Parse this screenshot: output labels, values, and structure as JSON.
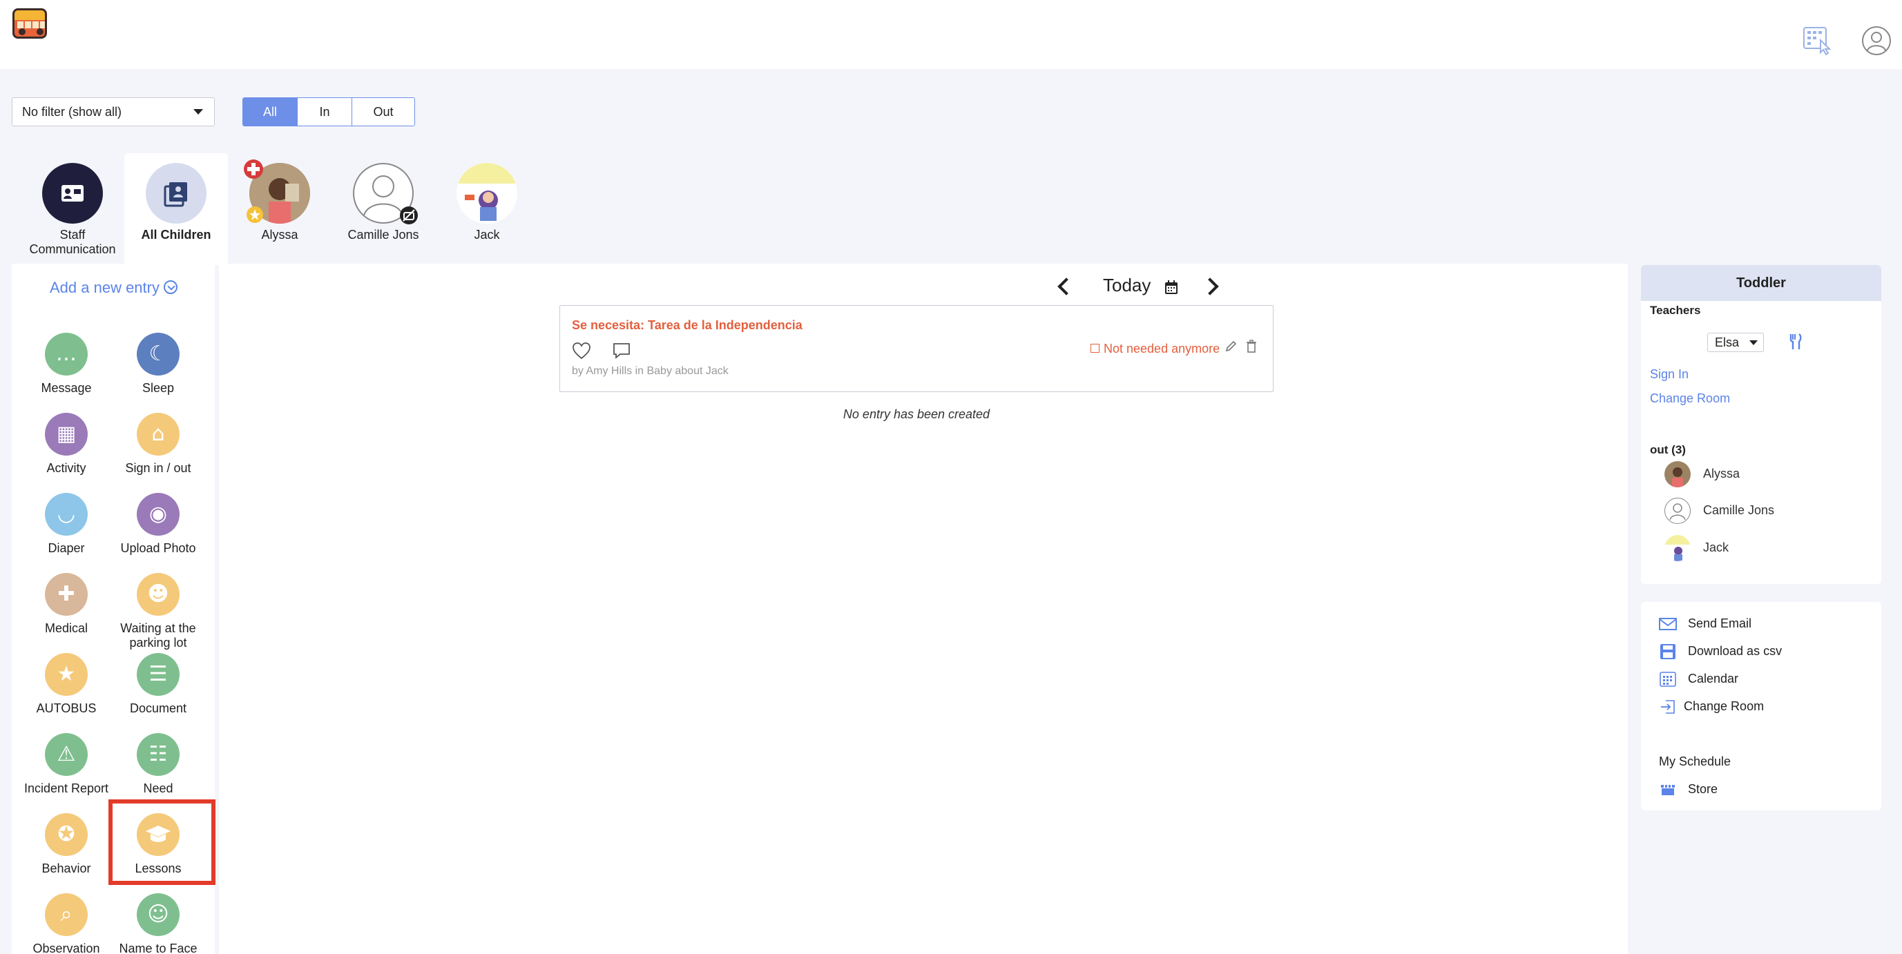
{
  "header": {
    "logo_icon": "school-bus-logo",
    "grid_icon": "keypad-icon",
    "user_icon": "user-profile-icon"
  },
  "filters": {
    "select_value": "No filter (show all)",
    "segments": [
      "All",
      "In",
      "Out"
    ],
    "active_segment": "All"
  },
  "children": [
    {
      "label": "Staff Communication",
      "icon": "staff-card-icon"
    },
    {
      "label": "All Children",
      "icon": "children-list-icon",
      "selected": true
    },
    {
      "label": "Alyssa",
      "icon": "child-photo"
    },
    {
      "label": "Camille Jons",
      "icon": "default-avatar"
    },
    {
      "label": "Jack",
      "icon": "child-illustration"
    }
  ],
  "sidebar": {
    "add_entry": "Add a new entry",
    "tiles": [
      {
        "label": "Message",
        "color": "#7fbf8f",
        "glyph": "…"
      },
      {
        "label": "Sleep",
        "color": "#5c7fbf",
        "glyph": "☾"
      },
      {
        "label": "Activity",
        "color": "#9a7ab8",
        "glyph": "▦"
      },
      {
        "label": "Sign in / out",
        "color": "#f5c97a",
        "glyph": "⌂"
      },
      {
        "label": "Diaper",
        "color": "#8dc6e8",
        "glyph": "◡"
      },
      {
        "label": "Upload Photo",
        "color": "#9a7ab8",
        "glyph": "◉"
      },
      {
        "label": "Medical",
        "color": "#d9b79a",
        "glyph": "✚"
      },
      {
        "label": "Waiting at the parking lot",
        "color": "#f5c97a",
        "glyph": "☻"
      },
      {
        "label": "AUTOBUS",
        "color": "#f5c97a",
        "glyph": "★"
      },
      {
        "label": "Document",
        "color": "#7fbf8f",
        "glyph": "☰"
      },
      {
        "label": "Incident Report",
        "color": "#7fbf8f",
        "glyph": "⚠"
      },
      {
        "label": "Need",
        "color": "#7fbf8f",
        "glyph": "☷"
      },
      {
        "label": "Behavior",
        "color": "#f5c97a",
        "glyph": "✪"
      },
      {
        "label": "Lessons",
        "color": "#f5c97a",
        "glyph": "🎓"
      },
      {
        "label": "Observation",
        "color": "#f5c97a",
        "glyph": "⌕"
      },
      {
        "label": "Name to Face",
        "color": "#7fbf8f",
        "glyph": "☺"
      }
    ]
  },
  "center": {
    "date_label": "Today",
    "entry": {
      "title": "Se necesita: Tarea de la Independencia",
      "by": "by Amy Hills in Baby about Jack",
      "not_needed": "Not needed anymore"
    },
    "no_entry": "No entry has been created"
  },
  "room": {
    "title": "Toddler",
    "teachers_label": "Teachers",
    "teacher_selected": "Elsa",
    "sign_in": "Sign In",
    "change_room": "Change Room",
    "out_label": "out (3)",
    "out_children": [
      "Alyssa",
      "Camille Jons",
      "Jack"
    ]
  },
  "actions": {
    "send_email": "Send Email",
    "download_csv": "Download as csv",
    "calendar": "Calendar",
    "change_room": "Change Room",
    "my_schedule": "My Schedule",
    "store": "Store"
  }
}
